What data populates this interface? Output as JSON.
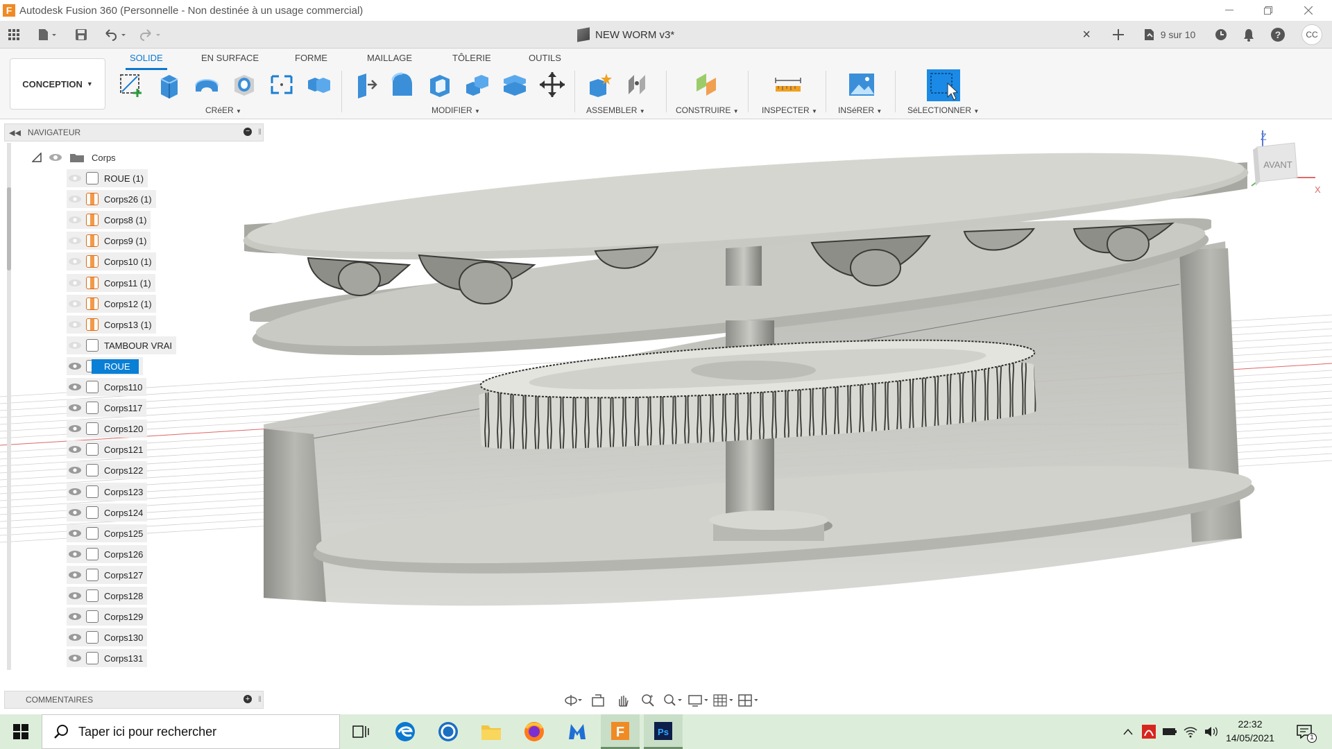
{
  "window": {
    "title": "Autodesk Fusion 360 (Personnelle - Non destinée à un usage commercial)",
    "minimize_icon": "minimize-icon",
    "maximize_icon": "restore-icon",
    "close_icon": "close-icon"
  },
  "quick_access": {
    "document_title": "NEW WORM v3*",
    "job_status": "9 sur 10",
    "user_initials": "CC"
  },
  "ribbon": {
    "workspace": "CONCEPTION",
    "tabs": [
      "SOLIDE",
      "EN SURFACE",
      "FORME",
      "MAILLAGE",
      "TÔLERIE",
      "OUTILS"
    ],
    "active_tab": "SOLIDE",
    "groups": {
      "creer": "CRéER",
      "modifier": "MODIFIER",
      "assembler": "ASSEMBLER",
      "construire": "CONSTRUIRE",
      "inspecter": "INSPECTER",
      "inserer": "INSéRER",
      "selectionner": "SéLECTIONNER"
    },
    "accent_color": "#0a78d0"
  },
  "navigator": {
    "header": "NAVIGATEUR",
    "folder": "Corps",
    "items": [
      {
        "label": "ROUE (1)",
        "visible": false,
        "component": false
      },
      {
        "label": "Corps26 (1)",
        "visible": false,
        "component": true
      },
      {
        "label": "Corps8 (1)",
        "visible": false,
        "component": true
      },
      {
        "label": "Corps9 (1)",
        "visible": false,
        "component": true
      },
      {
        "label": "Corps10 (1)",
        "visible": false,
        "component": true
      },
      {
        "label": "Corps11 (1)",
        "visible": false,
        "component": true
      },
      {
        "label": "Corps12 (1)",
        "visible": false,
        "component": true
      },
      {
        "label": "Corps13 (1)",
        "visible": false,
        "component": true
      },
      {
        "label": "TAMBOUR VRAI",
        "visible": false,
        "component": false
      },
      {
        "label": "ROUE",
        "visible": true,
        "component": false,
        "selected": true
      },
      {
        "label": "Corps110",
        "visible": true,
        "component": false
      },
      {
        "label": "Corps117",
        "visible": true,
        "component": false
      },
      {
        "label": "Corps120",
        "visible": true,
        "component": false
      },
      {
        "label": "Corps121",
        "visible": true,
        "component": false
      },
      {
        "label": "Corps122",
        "visible": true,
        "component": false
      },
      {
        "label": "Corps123",
        "visible": true,
        "component": false
      },
      {
        "label": "Corps124",
        "visible": true,
        "component": false
      },
      {
        "label": "Corps125",
        "visible": true,
        "component": false
      },
      {
        "label": "Corps126",
        "visible": true,
        "component": false
      },
      {
        "label": "Corps127",
        "visible": true,
        "component": false
      },
      {
        "label": "Corps128",
        "visible": true,
        "component": false
      },
      {
        "label": "Corps129",
        "visible": true,
        "component": false
      },
      {
        "label": "Corps130",
        "visible": true,
        "component": false
      },
      {
        "label": "Corps131",
        "visible": true,
        "component": false
      }
    ]
  },
  "viewcube": {
    "face": "AVANT",
    "axis_z": "Z",
    "axis_x": "X"
  },
  "comments": {
    "header": "COMMENTAIRES"
  },
  "taskbar": {
    "search_placeholder": "Taper ici pour rechercher",
    "time": "22:32",
    "date": "14/05/2021",
    "notification_count": "1"
  }
}
